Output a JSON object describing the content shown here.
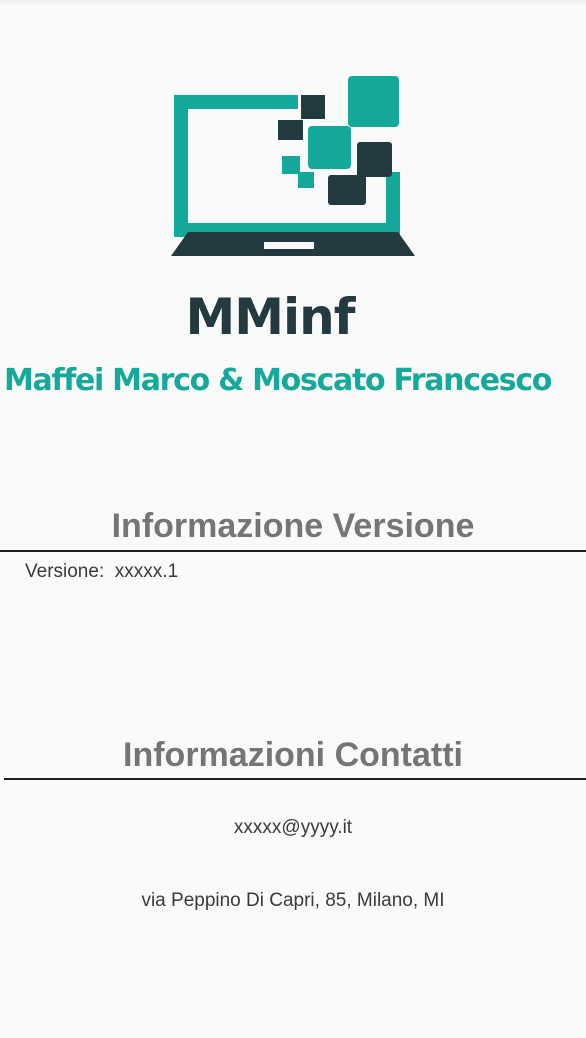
{
  "brand": {
    "name": "MMinf",
    "owners": "Maffei Marco &  Moscato Francesco"
  },
  "version_section": {
    "title": "Informazione Versione",
    "label": "Versione:",
    "value": "xxxxx.1"
  },
  "contacts_section": {
    "title": "Informazioni Contatti",
    "email": "xxxxx@yyyy.it",
    "address": "via Peppino Di Capri, 85, Milano, MI"
  },
  "colors": {
    "teal": "#14a99a",
    "dark": "#223a40",
    "title_gray": "#757575",
    "background": "#fafafa"
  },
  "icons": {
    "logo": "laptop-pixel-logo"
  }
}
